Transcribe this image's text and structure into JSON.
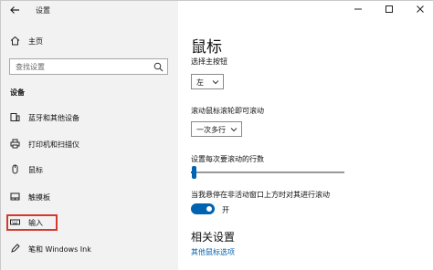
{
  "window": {
    "app_title": "设置"
  },
  "sidebar": {
    "home_label": "主页",
    "search_placeholder": "查找设置",
    "section_title": "设备",
    "items": [
      {
        "label": "蓝牙和其他设备",
        "icon": "bluetooth-devices-icon"
      },
      {
        "label": "打印机和扫描仪",
        "icon": "printer-icon"
      },
      {
        "label": "鼠标",
        "icon": "mouse-icon"
      },
      {
        "label": "触摸板",
        "icon": "touchpad-icon"
      },
      {
        "label": "输入",
        "icon": "keyboard-icon"
      },
      {
        "label": "笔和 Windows Ink",
        "icon": "pen-icon"
      }
    ]
  },
  "main": {
    "title": "鼠标",
    "primary_button": {
      "label": "选择主按钮",
      "value": "左"
    },
    "scroll_action": {
      "label": "滚动鼠标滚轮即可滚动",
      "value": "一次多行"
    },
    "lines_to_scroll": {
      "label": "设置每次要滚动的行数",
      "level_fraction": 0.02
    },
    "inactive_scroll": {
      "label": "当我悬停在非活动窗口上方时对其进行滚动",
      "state_text": "开",
      "on": true
    },
    "related": {
      "title": "相关设置",
      "link": "其他鼠标选项"
    }
  },
  "colors": {
    "accent": "#0063b1",
    "sidebar_bg": "#f2f2f2",
    "highlight": "#d23a2f"
  }
}
